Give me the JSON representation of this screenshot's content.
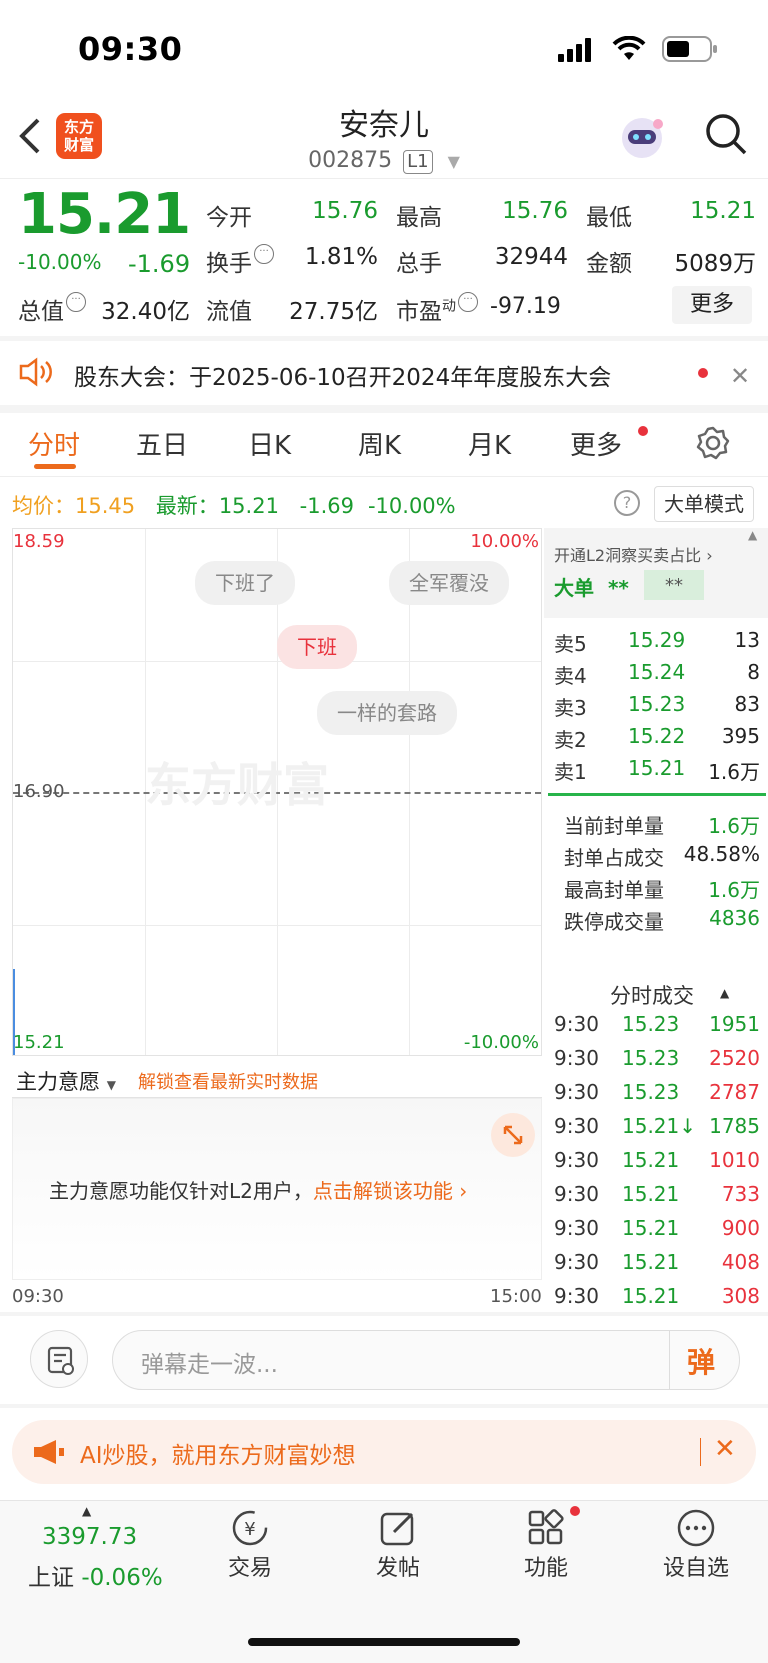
{
  "status": {
    "time": "09:30"
  },
  "header": {
    "name": "安奈儿",
    "code": "002875",
    "level": "L1",
    "logo_line1": "东方",
    "logo_line2": "财富"
  },
  "quote": {
    "price": "15.21",
    "pct": "-10.00%",
    "change": "-1.69",
    "open_label": "今开",
    "open": "15.76",
    "high_label": "最高",
    "high": "15.76",
    "low_label": "最低",
    "low": "15.21",
    "turnover_label": "换手",
    "turnover": "1.81%",
    "volume_label": "总手",
    "volume": "32944",
    "amount_label": "金额",
    "amount": "5089万",
    "mcap_label": "总值",
    "mcap": "32.40亿",
    "float_label": "流值",
    "float": "27.75亿",
    "pe_label": "市盈",
    "pe_sup": "动",
    "pe": "-97.19",
    "more": "更多"
  },
  "notice": {
    "text": "股东大会：于2025-06-10召开2024年年度股东大会"
  },
  "tabs": [
    "分时",
    "五日",
    "日K",
    "周K",
    "月K",
    "更多"
  ],
  "info": {
    "avg_label": "均价：",
    "avg": "15.45",
    "latest_label": "最新：",
    "latest": "15.21",
    "latest_chg": "-1.69",
    "latest_pct": "-10.00%",
    "big_order_mode": "大单模式"
  },
  "chart": {
    "top_price": "18.59",
    "top_pct": "10.00%",
    "mid_price": "16.90",
    "bottom_price": "15.21",
    "bottom_pct": "-10.00%",
    "time_start": "09:30",
    "time_end": "15:00",
    "watermark": "东方财富",
    "danmu": [
      "下班了",
      "全军覆没",
      "下班",
      "一样的套路"
    ]
  },
  "right_panel": {
    "l2_text": "开通L2洞察买卖占比",
    "big_label": "大单",
    "big_v1": "**",
    "big_v2": "**",
    "orderbook": [
      {
        "label": "卖5",
        "price": "15.29",
        "vol": "13"
      },
      {
        "label": "卖4",
        "price": "15.24",
        "vol": "8"
      },
      {
        "label": "卖3",
        "price": "15.23",
        "vol": "83"
      },
      {
        "label": "卖2",
        "price": "15.22",
        "vol": "395"
      },
      {
        "label": "卖1",
        "price": "15.21",
        "vol": "1.6万"
      }
    ],
    "stats": [
      {
        "label": "当前封单量",
        "value": "1.6万"
      },
      {
        "label": "封单占成交",
        "value": "48.58%"
      },
      {
        "label": "最高封单量",
        "value": "1.6万"
      },
      {
        "label": "跌停成交量",
        "value": "4836"
      }
    ],
    "trades_title": "分时成交",
    "trades": [
      {
        "time": "9:30",
        "price": "15.23",
        "vol": "1951"
      },
      {
        "time": "9:30",
        "price": "15.23",
        "vol": "2520"
      },
      {
        "time": "9:30",
        "price": "15.23",
        "vol": "2787"
      },
      {
        "time": "9:30",
        "price": "15.21↓",
        "vol": "1785"
      },
      {
        "time": "9:30",
        "price": "15.21",
        "vol": "1010"
      },
      {
        "time": "9:30",
        "price": "15.21",
        "vol": "733"
      },
      {
        "time": "9:30",
        "price": "15.21",
        "vol": "900"
      },
      {
        "time": "9:30",
        "price": "15.21",
        "vol": "408"
      },
      {
        "time": "9:30",
        "price": "15.21",
        "vol": "308"
      }
    ]
  },
  "main_force": {
    "select": "主力意愿",
    "unlock_link": "解锁查看最新实时数据",
    "msg": "主力意愿功能仅针对L2用户，",
    "msg_link": "点击解锁该功能"
  },
  "comment": {
    "placeholder": "弹幕走一波...",
    "send": "弹"
  },
  "ad": {
    "text": "AI炒股，就用东方财富妙想"
  },
  "bottom_nav": {
    "index_value": "3397.73",
    "index_name": "上证",
    "index_pct": "-0.06%",
    "items": [
      "交易",
      "发帖",
      "功能",
      "设自选"
    ]
  }
}
